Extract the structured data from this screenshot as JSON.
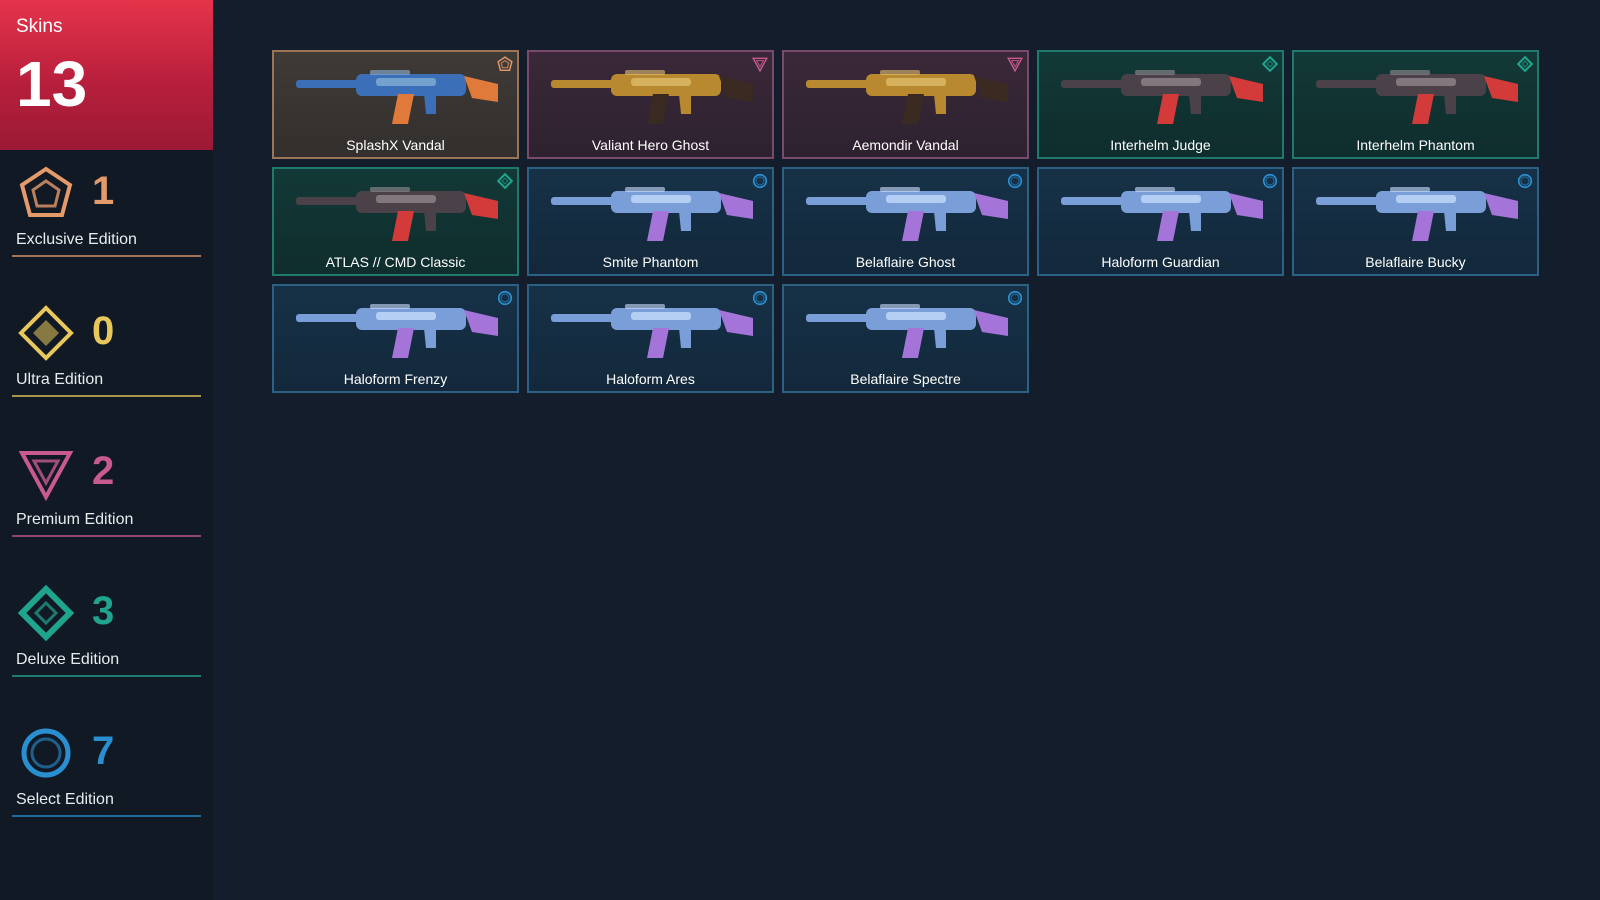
{
  "summary": {
    "label": "Skins",
    "total": "13"
  },
  "colors": {
    "exclusive": "#e59a6a",
    "ultra": "#e8c85a",
    "premium": "#c85a90",
    "deluxe": "#1fa58e",
    "select": "#2a8fd0"
  },
  "tiers": [
    {
      "key": "exclusive",
      "icon": "exclusive-edition-icon",
      "count": "1",
      "label": "Exclusive Edition"
    },
    {
      "key": "ultra",
      "icon": "ultra-edition-icon",
      "count": "0",
      "label": "Ultra Edition"
    },
    {
      "key": "premium",
      "icon": "premium-edition-icon",
      "count": "2",
      "label": "Premium Edition"
    },
    {
      "key": "deluxe",
      "icon": "deluxe-edition-icon",
      "count": "3",
      "label": "Deluxe Edition"
    },
    {
      "key": "select",
      "icon": "select-edition-icon",
      "count": "7",
      "label": "Select Edition"
    }
  ],
  "skins": [
    {
      "name": "SplashX Vandal",
      "tier": "exclusive",
      "icon": "vandal-weapon-icon"
    },
    {
      "name": "Valiant Hero Ghost",
      "tier": "premium",
      "icon": "ghost-weapon-icon"
    },
    {
      "name": "Aemondir Vandal",
      "tier": "premium",
      "icon": "vandal-weapon-icon"
    },
    {
      "name": "Interhelm Judge",
      "tier": "deluxe",
      "icon": "judge-weapon-icon"
    },
    {
      "name": "Interhelm Phantom",
      "tier": "deluxe",
      "icon": "phantom-weapon-icon"
    },
    {
      "name": "ATLAS // CMD Classic",
      "tier": "deluxe",
      "icon": "classic-weapon-icon"
    },
    {
      "name": "Smite Phantom",
      "tier": "select",
      "icon": "phantom-weapon-icon"
    },
    {
      "name": "Belaflaire Ghost",
      "tier": "select",
      "icon": "ghost-weapon-icon"
    },
    {
      "name": "Haloform Guardian",
      "tier": "select",
      "icon": "guardian-weapon-icon"
    },
    {
      "name": "Belaflaire Bucky",
      "tier": "select",
      "icon": "bucky-weapon-icon"
    },
    {
      "name": "Haloform Frenzy",
      "tier": "select",
      "icon": "frenzy-weapon-icon"
    },
    {
      "name": "Haloform Ares",
      "tier": "select",
      "icon": "ares-weapon-icon"
    },
    {
      "name": "Belaflaire Spectre",
      "tier": "select",
      "icon": "spectre-weapon-icon"
    }
  ]
}
